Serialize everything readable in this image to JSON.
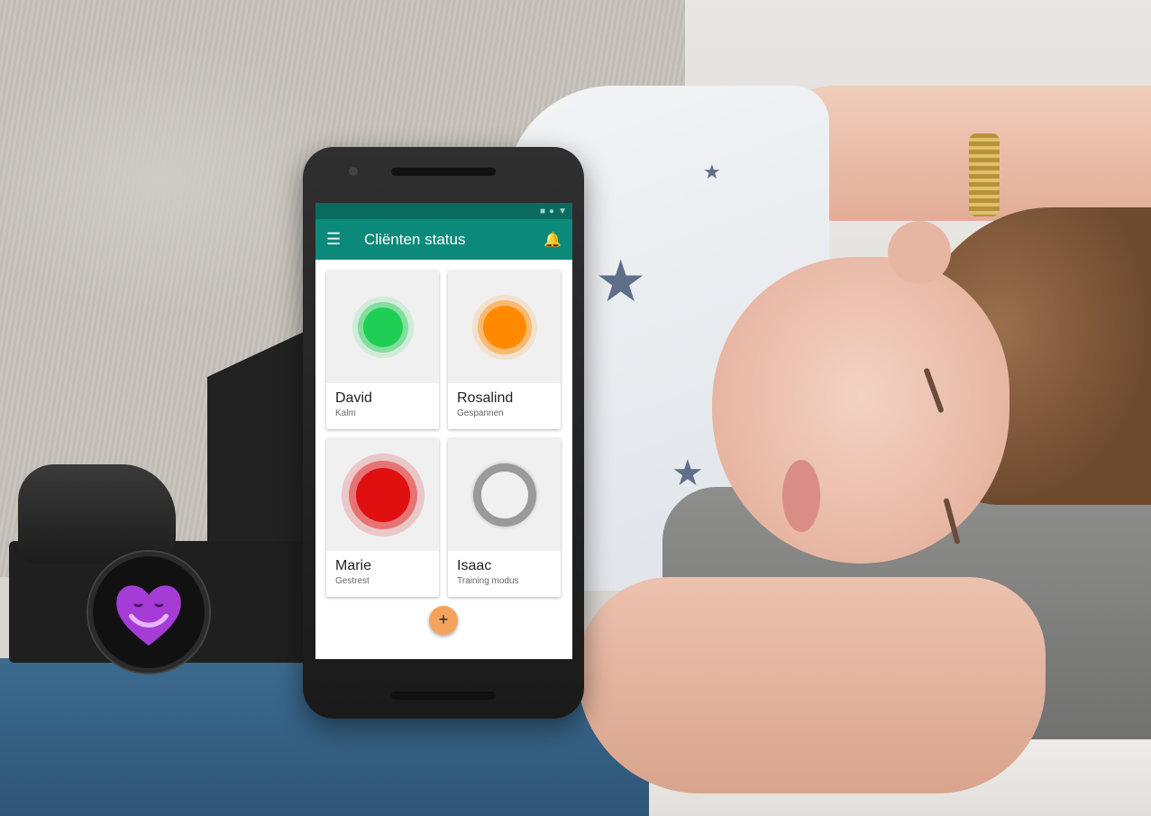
{
  "app": {
    "title": "Cliënten status",
    "menu_icon": "hamburger-menu-icon",
    "notification_icon": "bell-icon"
  },
  "statusbar": {
    "icons": [
      "square-icon",
      "dot-icon",
      "triangle-icon"
    ]
  },
  "clients": [
    {
      "name": "David",
      "status": "Kalm",
      "color": "#1fcf55",
      "state_icon": "green-circle"
    },
    {
      "name": "Rosalind",
      "status": "Gespannen",
      "color": "#ff8a00",
      "state_icon": "orange-circle"
    },
    {
      "name": "Marie",
      "status": "Gestrest",
      "color": "#e01010",
      "state_icon": "red-circle"
    },
    {
      "name": "Isaac",
      "status": "Training modus",
      "color": "#9a9a9a",
      "state_icon": "grey-ring"
    }
  ],
  "fab": {
    "label": "+"
  },
  "colors": {
    "primary": "#0b897a",
    "primary_dark": "#0c6b60",
    "accent": "#f4a45a",
    "logo": "#a53cd6"
  }
}
